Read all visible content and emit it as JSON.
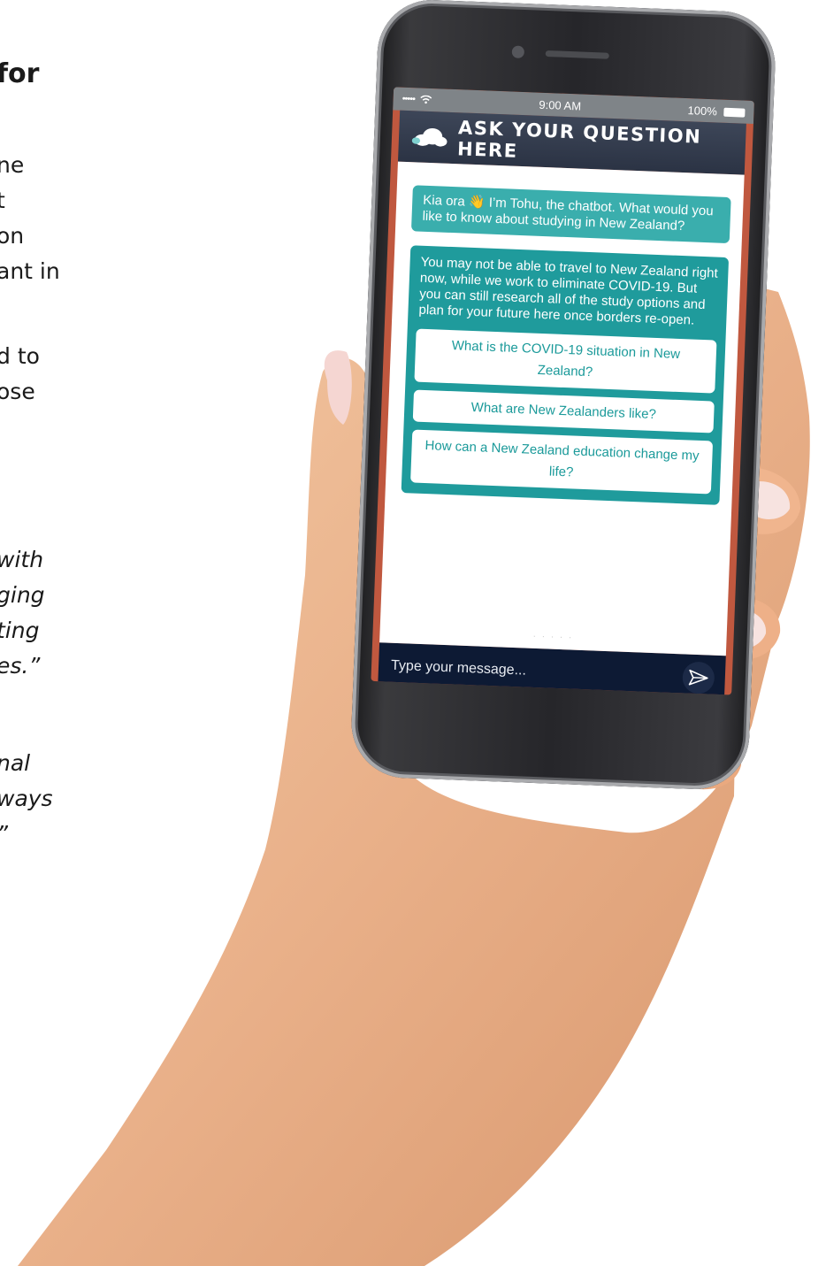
{
  "document": {
    "heading_fragment": "for",
    "para1": [
      "ne",
      "t",
      "on",
      "ant in"
    ],
    "para2": [
      "d to",
      "ose"
    ],
    "quote1": [
      "with",
      "ging",
      "ting",
      "es.”"
    ],
    "quote2": [
      "nal",
      "ways",
      "”"
    ]
  },
  "phone": {
    "status": {
      "time": "9:00 AM",
      "battery": "100%",
      "signal": "•••••"
    },
    "chat": {
      "header_title": "ASK YOUR QUESTION HERE",
      "greeting": "Kia ora 👋 I’m Tohu, the chatbot. What would you like to know about studying in New Zealand?",
      "info": "You may not be able to travel to New Zealand right now, while we work to eliminate COVID-19. But you can still research all of the study options and plan for your future here once borders re-open.",
      "quick_replies": [
        "What is the COVID-19 situation in New Zealand?",
        "What are New Zealanders like?",
        "How can a New Zealand education change my life?"
      ],
      "input_placeholder": "Type your message..."
    }
  },
  "colors": {
    "teal": "#1f9b9c",
    "teal_light": "#3aaead",
    "header": "#2b3344",
    "composer": "#0d1a34",
    "accent_red": "#c0583f"
  }
}
